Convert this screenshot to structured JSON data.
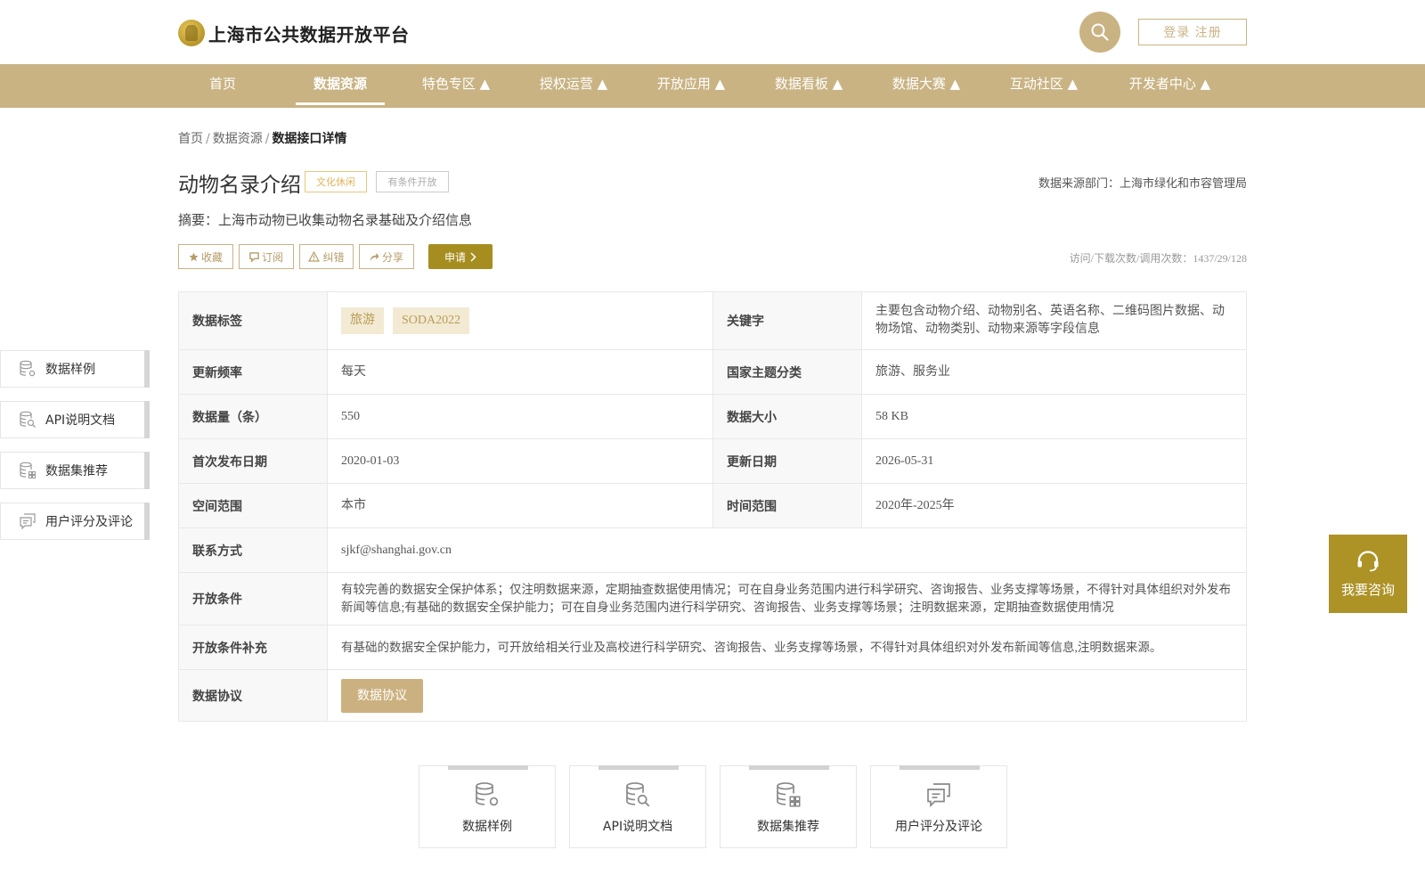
{
  "header": {
    "logo_text": "上海市公共数据开放平台",
    "login_label": "登录 注册"
  },
  "nav": {
    "items": [
      {
        "label": "首页"
      },
      {
        "label": "数据资源"
      },
      {
        "label": "特色专区 ▲"
      },
      {
        "label": "授权运营 ▲"
      },
      {
        "label": "开放应用 ▲"
      },
      {
        "label": "数据看板 ▲"
      },
      {
        "label": "数据大赛 ▲"
      },
      {
        "label": "互动社区 ▲"
      },
      {
        "label": "开发者中心 ▲"
      }
    ],
    "active": "数据资源"
  },
  "breadcrumb": {
    "items": [
      "首页",
      "数据资源",
      "数据接口详情"
    ],
    "separator": "/"
  },
  "resource": {
    "title": "动物名录介绍",
    "tag_category": "文化休闲",
    "tag_open": "有条件开放",
    "source": "数据来源部门：上海市绿化和市容管理局",
    "summary": "摘要：上海市动物已收集动物名录基础及介绍信息",
    "stats": "访问/下载次数/调用次数：1437/29/128"
  },
  "actions": {
    "favorite": "收藏",
    "subscribe": "订阅",
    "report": "纠错",
    "share": "分享",
    "apply": "申请"
  },
  "details": {
    "tags_label": "数据标签",
    "tags": [
      "旅游",
      "SODA2022"
    ],
    "keywords_label": "关键字",
    "keywords": "主要包含动物介绍、动物别名、英语名称、二维码图片数据、动物场馆、动物类别、动物来源等字段信息",
    "frequency_label": "更新频率",
    "frequency": "每天",
    "theme_label": "国家主题分类",
    "theme": "旅游、服务业",
    "count_label": "数据量（条）",
    "count": "550",
    "size_label": "数据大小",
    "size": "58 KB",
    "first_date_label": "首次发布日期",
    "first_date": "2020-01-03",
    "update_date_label": "更新日期",
    "update_date": "2026-05-31",
    "space_label": "空间范围",
    "space": "本市",
    "time_label": "时间范围",
    "time": "2020年-2025年",
    "contact_label": "联系方式",
    "contact": "sjkf@shanghai.gov.cn",
    "condition_label": "开放条件",
    "condition": "有较完善的数据安全保护体系；仅注明数据来源，定期抽查数据使用情况；可在自身业务范围内进行科学研究、咨询报告、业务支撑等场景，不得针对具体组织对外发布新闻等信息;有基础的数据安全保护能力；可在自身业务范围内进行科学研究、咨询报告、业务支撑等场景；注明数据来源，定期抽查数据使用情况",
    "condition_extra_label": "开放条件补充",
    "condition_extra": "有基础的数据安全保护能力，可开放给相关行业及高校进行科学研究、咨询报告、业务支撑等场景，不得针对具体组织对外发布新闻等信息,注明数据来源。",
    "protocol_label": "数据协议",
    "protocol_button": "数据协议"
  },
  "sidenav": {
    "items": [
      "数据样例",
      "API说明文档",
      "数据集推荐",
      "用户评分及评论"
    ]
  },
  "consult": {
    "label": "我要咨询"
  },
  "cards": {
    "items": [
      "数据样例",
      "API说明文档",
      "数据集推荐",
      "用户评分及评论"
    ]
  },
  "colors": {
    "brand": "#c9b383",
    "apply": "#a68d1f",
    "consult": "#ad9226"
  }
}
